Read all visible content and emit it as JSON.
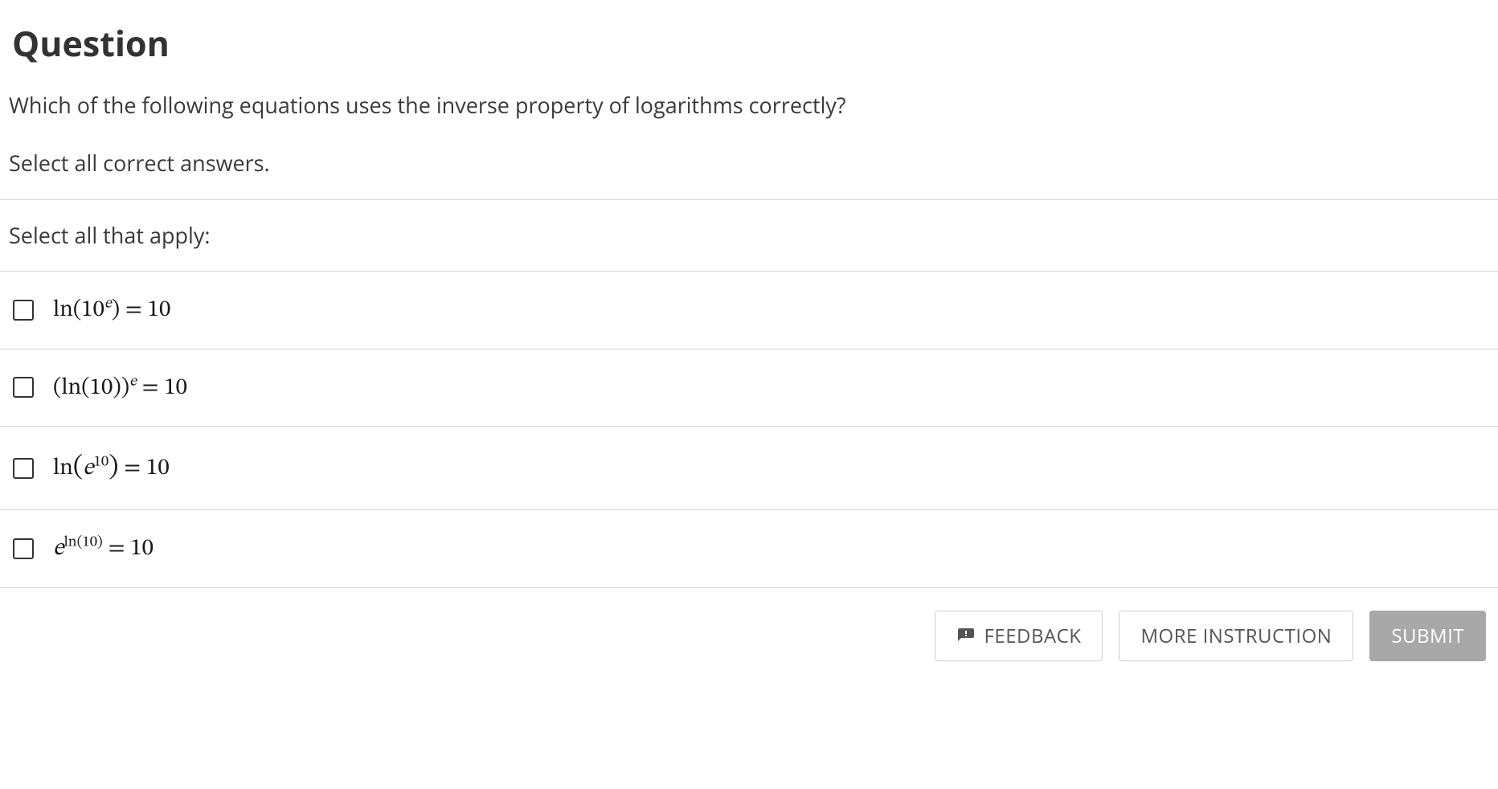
{
  "question": {
    "heading": "Question",
    "prompt": "Which of the following equations uses the inverse property of logarithms correctly?",
    "subprompt": "Select all correct answers.",
    "instruct": "Select all that apply:"
  },
  "options": [
    {
      "id": "opt-a",
      "latex": "ln(10^e) = 10"
    },
    {
      "id": "opt-b",
      "latex": "(ln(10))^e = 10"
    },
    {
      "id": "opt-c",
      "latex": "ln(e^{10}) = 10"
    },
    {
      "id": "opt-d",
      "latex": "e^{ln(10)} = 10"
    }
  ],
  "buttons": {
    "feedback": "FEEDBACK",
    "more": "MORE INSTRUCTION",
    "submit": "SUBMIT"
  }
}
